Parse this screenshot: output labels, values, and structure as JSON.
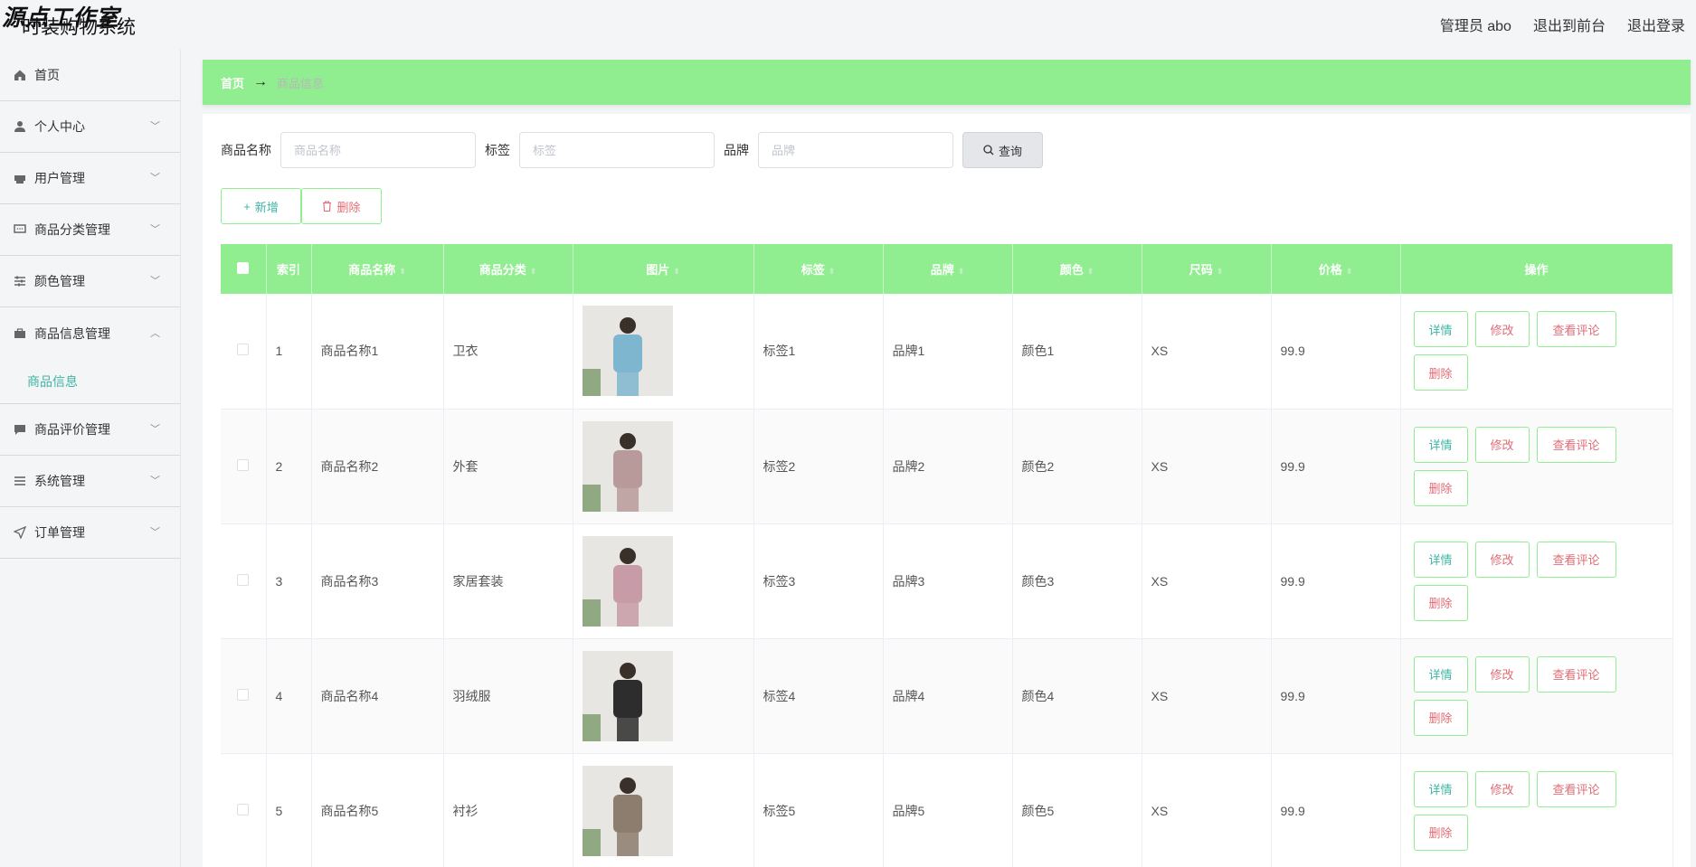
{
  "header": {
    "watermark": "源点工作室",
    "title": "时装购物系统",
    "links": [
      "管理员 abo",
      "退出到前台",
      "退出登录"
    ]
  },
  "sidebar": {
    "items": [
      {
        "label": "首页",
        "icon": "home-icon"
      },
      {
        "label": "个人中心",
        "icon": "user-icon"
      },
      {
        "label": "用户管理",
        "icon": "printer-icon"
      },
      {
        "label": "商品分类管理",
        "icon": "chat-icon"
      },
      {
        "label": "颜色管理",
        "icon": "sliders-icon"
      },
      {
        "label": "商品信息管理",
        "icon": "suitcase-icon",
        "open": true,
        "children": [
          "商品信息"
        ]
      },
      {
        "label": "商品评价管理",
        "icon": "message-icon"
      },
      {
        "label": "系统管理",
        "icon": "list-icon"
      },
      {
        "label": "订单管理",
        "icon": "send-icon"
      }
    ]
  },
  "breadcrumb": {
    "home": "首页",
    "arrow": "→",
    "current": "商品信息"
  },
  "search": {
    "name_label": "商品名称",
    "name_placeholder": "商品名称",
    "tag_label": "标签",
    "tag_placeholder": "标签",
    "brand_label": "品牌",
    "brand_placeholder": "品牌",
    "query_label": "查询"
  },
  "actions": {
    "add_label": "新增",
    "delete_label": "删除"
  },
  "table": {
    "headers": [
      "索引",
      "商品名称",
      "商品分类",
      "图片",
      "标签",
      "品牌",
      "颜色",
      "尺码",
      "价格",
      "操作"
    ],
    "rows": [
      {
        "index": "1",
        "name": "商品名称1",
        "category": "卫衣",
        "tag": "标签1",
        "brand": "品牌1",
        "color": "颜色1",
        "size": "XS",
        "price": "99.9",
        "img": "#7fb6cf"
      },
      {
        "index": "2",
        "name": "商品名称2",
        "category": "外套",
        "tag": "标签2",
        "brand": "品牌2",
        "color": "颜色2",
        "size": "XS",
        "price": "99.9",
        "img": "#b99a9a"
      },
      {
        "index": "3",
        "name": "商品名称3",
        "category": "家居套装",
        "tag": "标签3",
        "brand": "品牌3",
        "color": "颜色3",
        "size": "XS",
        "price": "99.9",
        "img": "#c79ba7"
      },
      {
        "index": "4",
        "name": "商品名称4",
        "category": "羽绒服",
        "tag": "标签4",
        "brand": "品牌4",
        "color": "颜色4",
        "size": "XS",
        "price": "99.9",
        "img": "#2d2d2d"
      },
      {
        "index": "5",
        "name": "商品名称5",
        "category": "衬衫",
        "tag": "标签5",
        "brand": "品牌5",
        "color": "颜色5",
        "size": "XS",
        "price": "99.9",
        "img": "#8c7d6e"
      }
    ],
    "row_actions": {
      "detail": "详情",
      "edit": "修改",
      "review": "查看评论",
      "delete": "删除"
    }
  },
  "colors": {
    "accent": "#90ee90",
    "link": "#3fb5a5",
    "danger": "#e06c75"
  }
}
